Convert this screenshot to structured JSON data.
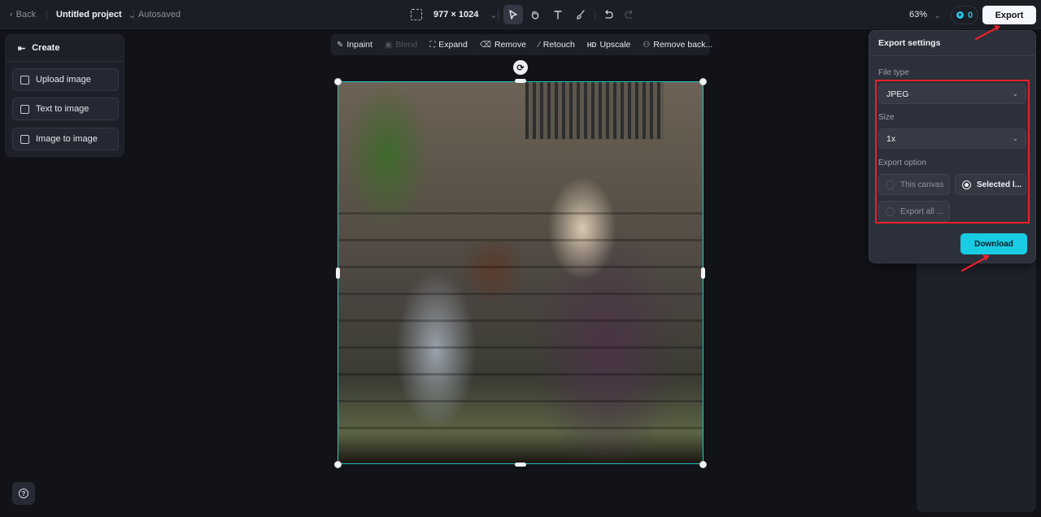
{
  "topbar": {
    "back_label": "Back",
    "project_title": "Untitled project",
    "save_status": "Autosaved",
    "canvas_size": "977 × 1024",
    "tools": [
      {
        "name": "select-tool",
        "icon": "pointer-icon",
        "active": true
      },
      {
        "name": "hand-tool",
        "icon": "hand-icon",
        "active": false
      },
      {
        "name": "text-tool",
        "icon": "text-icon",
        "active": false
      },
      {
        "name": "brush-tool",
        "icon": "brush-icon",
        "active": false
      },
      {
        "name": "undo",
        "icon": "undo-icon",
        "active": false
      },
      {
        "name": "redo",
        "icon": "redo-icon",
        "active": false,
        "disabled": true
      }
    ],
    "zoom_level": "63%",
    "credits": "0",
    "export_label": "Export"
  },
  "create_panel": {
    "title": "Create",
    "items": [
      {
        "label": "Upload image",
        "icon": "upload-image-icon"
      },
      {
        "label": "Text to image",
        "icon": "text-to-image-icon"
      },
      {
        "label": "Image to image",
        "icon": "image-to-image-icon"
      }
    ]
  },
  "edit_toolbar": {
    "items": [
      {
        "label": "Inpaint",
        "icon": "inpaint-icon",
        "disabled": false
      },
      {
        "label": "Blend",
        "icon": "blend-icon",
        "disabled": true
      },
      {
        "label": "Expand",
        "icon": "expand-icon",
        "disabled": false
      },
      {
        "label": "Remove",
        "icon": "eraser-icon",
        "disabled": false
      },
      {
        "label": "Retouch",
        "icon": "magic-wand-icon",
        "disabled": false
      },
      {
        "label": "Upscale",
        "icon": "hd-icon",
        "disabled": false
      },
      {
        "label": "Remove back...",
        "icon": "remove-background-icon",
        "disabled": false
      }
    ]
  },
  "export_settings": {
    "title": "Export settings",
    "file_type_label": "File type",
    "file_type_value": "JPEG",
    "size_label": "Size",
    "size_value": "1x",
    "export_option_label": "Export option",
    "options": [
      {
        "label": "This canvas",
        "selected": false
      },
      {
        "label": "Selected l...",
        "selected": true
      },
      {
        "label": "Export all ...",
        "selected": false
      }
    ],
    "download_label": "Download"
  },
  "colors": {
    "accent": "#18cce4",
    "selection": "#1fc6c4",
    "annotation": "#e8202a"
  },
  "help_icon": "?"
}
